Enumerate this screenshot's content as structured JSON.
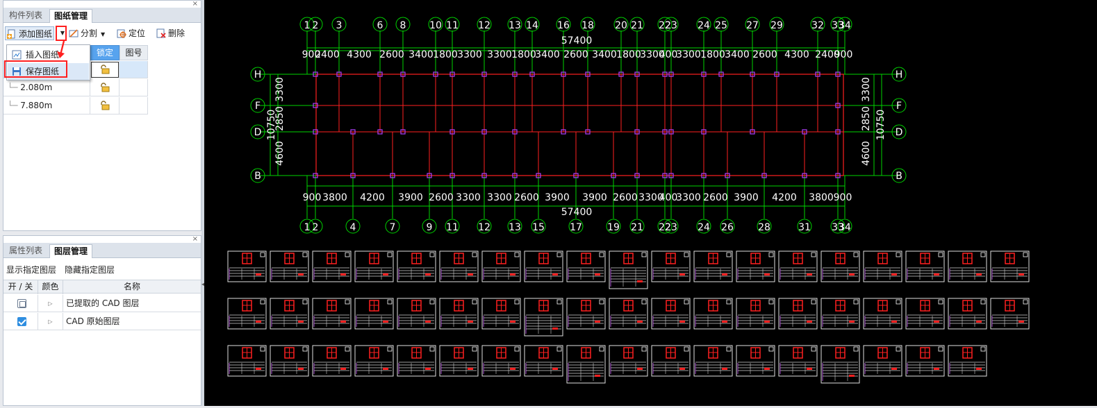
{
  "top_panel": {
    "tabs": [
      {
        "label": "构件列表"
      },
      {
        "label": "图纸管理"
      }
    ],
    "toolbar": {
      "add_drawing": "添加图纸",
      "split": "分割",
      "locate": "定位",
      "delete": "删除"
    },
    "grid": {
      "headers": {
        "lock": "锁定",
        "number": "图号"
      },
      "rows": [
        {
          "name": ""
        },
        {
          "name": "2.080m"
        },
        {
          "name": "7.880m"
        }
      ]
    },
    "dropdown": {
      "insert": "插入图纸",
      "save": "保存图纸"
    }
  },
  "bottom_panel": {
    "tabs": [
      {
        "label": "属性列表"
      },
      {
        "label": "图层管理"
      }
    ],
    "toolbar": {
      "show_layer": "显示指定图层",
      "hide_layer": "隐藏指定图层"
    },
    "headers": {
      "onoff": "开 / 关",
      "color": "颜色",
      "name": "名称"
    },
    "layers": [
      {
        "name": "已提取的 CAD 图层",
        "checked": false
      },
      {
        "name": "CAD 原始图层",
        "checked": true
      }
    ]
  },
  "cad": {
    "top_axes": [
      "1",
      "2",
      "3",
      "6",
      "8",
      "10",
      "11",
      "12",
      "13",
      "14",
      "16",
      "18",
      "20",
      "21",
      "22",
      "23",
      "24",
      "25",
      "27",
      "29",
      "32",
      "33",
      "34"
    ],
    "bottom_axes": [
      "1",
      "2",
      "4",
      "7",
      "9",
      "11",
      "12",
      "13",
      "15",
      "17",
      "19",
      "21",
      "22",
      "23",
      "24",
      "26",
      "28",
      "31",
      "33",
      "34"
    ],
    "row_axes": [
      "H",
      "F",
      "D",
      "B"
    ],
    "total_top": "57400",
    "total_bottom": "57400",
    "top_dims": [
      "900",
      "2400",
      "4300",
      "2600",
      "3400",
      "1800",
      "3300",
      "3300",
      "1800",
      "3400",
      "2600",
      "3400",
      "1800",
      "3300",
      "400",
      "3300",
      "1800",
      "3400",
      "2600",
      "4300",
      "2400",
      "900"
    ],
    "bottom_dims": [
      "900",
      "3800",
      "4200",
      "3900",
      "2600",
      "3300",
      "3300",
      "2600",
      "3900",
      "3900",
      "2600",
      "3300",
      "400",
      "3300",
      "2600",
      "3900",
      "4200",
      "3800",
      "900"
    ],
    "side_dims": [
      "3300",
      "2850",
      "4600"
    ],
    "side_total": "10750",
    "colors": {
      "grid": "#00d400",
      "beam": "#ff2020",
      "column": "#b040ff",
      "text": "#ffffff",
      "thumb_border": "#e0e0e0"
    },
    "thumbnail_rows": [
      19,
      19,
      18
    ]
  }
}
